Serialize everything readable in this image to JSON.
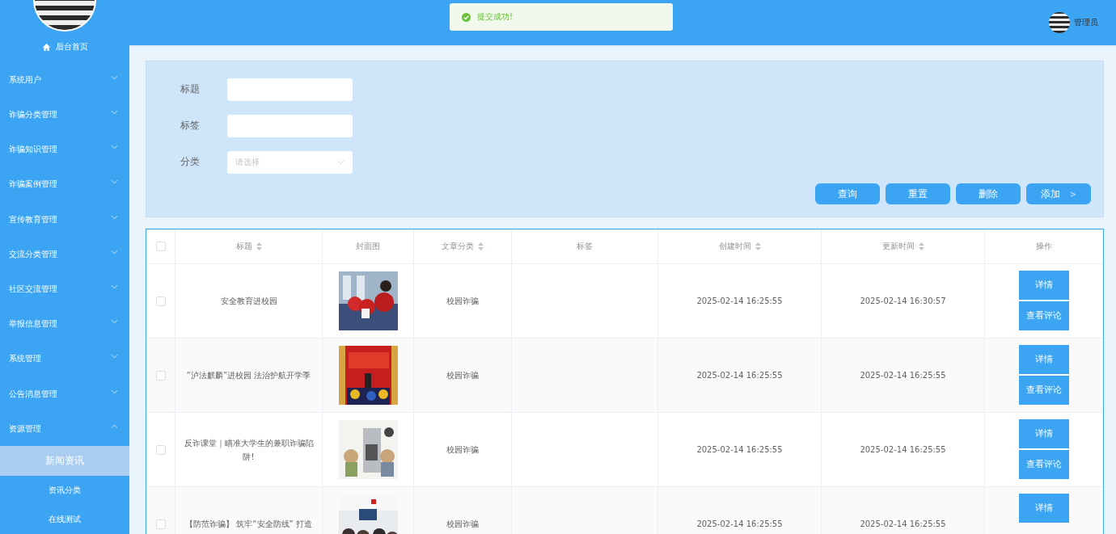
{
  "sidebar": {
    "home": "后台首页",
    "items": [
      {
        "label": "系统用户",
        "expanded": false
      },
      {
        "label": "诈骗分类管理",
        "expanded": false
      },
      {
        "label": "诈骗知识管理",
        "expanded": false
      },
      {
        "label": "诈骗案例管理",
        "expanded": false
      },
      {
        "label": "宣传教育管理",
        "expanded": false
      },
      {
        "label": "交流分类管理",
        "expanded": false
      },
      {
        "label": "社区交流管理",
        "expanded": false
      },
      {
        "label": "举报信息管理",
        "expanded": false
      },
      {
        "label": "系统管理",
        "expanded": false
      },
      {
        "label": "公告消息管理",
        "expanded": false
      },
      {
        "label": "资源管理",
        "expanded": true,
        "children": [
          {
            "label": "新闻资讯",
            "selected": true
          },
          {
            "label": "资讯分类",
            "selected": false
          },
          {
            "label": "在线测试",
            "selected": false
          }
        ]
      }
    ]
  },
  "toast": {
    "message": "提交成功!"
  },
  "header": {
    "user": "管理员"
  },
  "search": {
    "fields": [
      {
        "label": "标题",
        "kind": "input"
      },
      {
        "label": "标签",
        "kind": "input"
      },
      {
        "label": "分类",
        "kind": "select",
        "placeholder": "请选择"
      }
    ],
    "buttons": [
      "查询",
      "重置",
      "删除",
      "添加"
    ],
    "more": ">"
  },
  "table": {
    "all_checked": false,
    "columns": [
      {
        "label": "标题",
        "sortable": true
      },
      {
        "label": "封面图",
        "sortable": false
      },
      {
        "label": "文章分类",
        "sortable": true
      },
      {
        "label": "标签",
        "sortable": false
      },
      {
        "label": "创建时间",
        "sortable": true
      },
      {
        "label": "更新时间",
        "sortable": true
      },
      {
        "label": "操作",
        "sortable": false
      }
    ],
    "rows": [
      {
        "title": "安全教育进校园",
        "category": "校园诈骗",
        "created": "2025-02-14 16:25:55",
        "updated": "2025-02-14 16:30:57",
        "checked": false,
        "actions": [
          "详情",
          "查看评论"
        ]
      },
      {
        "title": "“泸法麒麟”进校园 法治护航开学季",
        "category": "校园诈骗",
        "created": "2025-02-14 16:25:55",
        "updated": "2025-02-14 16:25:55",
        "checked": false,
        "actions": [
          "详情",
          "查看评论"
        ]
      },
      {
        "title": "反诈课堂｜瞄准大学生的兼职诈骗陷阱!",
        "category": "校园诈骗",
        "created": "2025-02-14 16:25:55",
        "updated": "2025-02-14 16:25:55",
        "checked": false,
        "actions": [
          "详情",
          "查看评论"
        ]
      },
      {
        "title": "【防范诈骗】 筑牢“安全防线” 打造",
        "category": "校园诈骗",
        "created": "2025-02-14 16:25:55",
        "updated": "2025-02-14 16:25:55",
        "checked": false,
        "actions": [
          "详情"
        ]
      }
    ]
  }
}
